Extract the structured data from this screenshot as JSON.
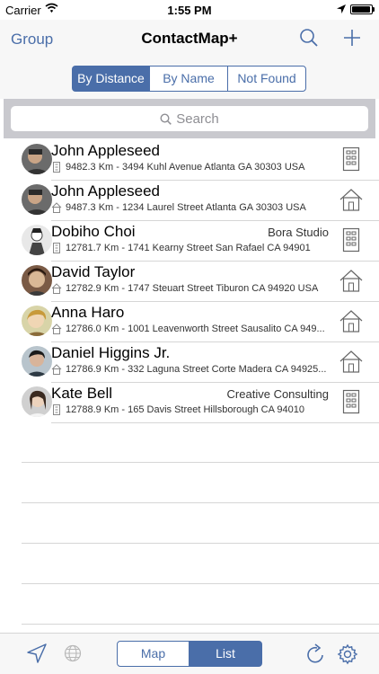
{
  "status_bar": {
    "carrier": "Carrier",
    "time": "1:55 PM",
    "battery_level": 0.95
  },
  "nav": {
    "back_label": "Group",
    "title": "ContactMap+",
    "search_icon": "search-icon",
    "add_icon": "plus-icon"
  },
  "sort_tabs": [
    "By Distance",
    "By Name",
    "Not Found"
  ],
  "sort_active": "By Distance",
  "search": {
    "placeholder": "Search"
  },
  "contacts": [
    {
      "name": "John Appleseed",
      "company": "",
      "distance_address": "9482.3 Km - 3494 Kuhl Avenue Atlanta GA 30303 USA",
      "address_type": "work"
    },
    {
      "name": "John Appleseed",
      "company": "",
      "distance_address": "9487.3 Km - 1234 Laurel Street Atlanta GA 30303 USA",
      "address_type": "home"
    },
    {
      "name": "Dobiho Choi",
      "company": "Bora Studio",
      "distance_address": "12781.7 Km - 1741 Kearny Street San Rafael CA 94901",
      "address_type": "work"
    },
    {
      "name": "David Taylor",
      "company": "",
      "distance_address": "12782.9 Km - 1747 Steuart Street Tiburon CA 94920 USA",
      "address_type": "home"
    },
    {
      "name": "Anna Haro",
      "company": "",
      "distance_address": "12786.0 Km - 1001  Leavenworth Street Sausalito CA 949...",
      "address_type": "home"
    },
    {
      "name": "Daniel Higgins Jr.",
      "company": "",
      "distance_address": "12786.9 Km - 332 Laguna Street Corte Madera CA 94925...",
      "address_type": "home"
    },
    {
      "name": "Kate Bell",
      "company": "Creative Consulting",
      "distance_address": "12788.9 Km - 165 Davis Street Hillsborough CA 94010",
      "address_type": "work"
    }
  ],
  "toolbar": {
    "map_label": "Map",
    "list_label": "List",
    "active": "List"
  },
  "colors": {
    "accent": "#4a6ea9",
    "nav_bg": "#f7f7f7",
    "search_bg": "#c9c9ce",
    "divider": "#d6d6d6"
  }
}
